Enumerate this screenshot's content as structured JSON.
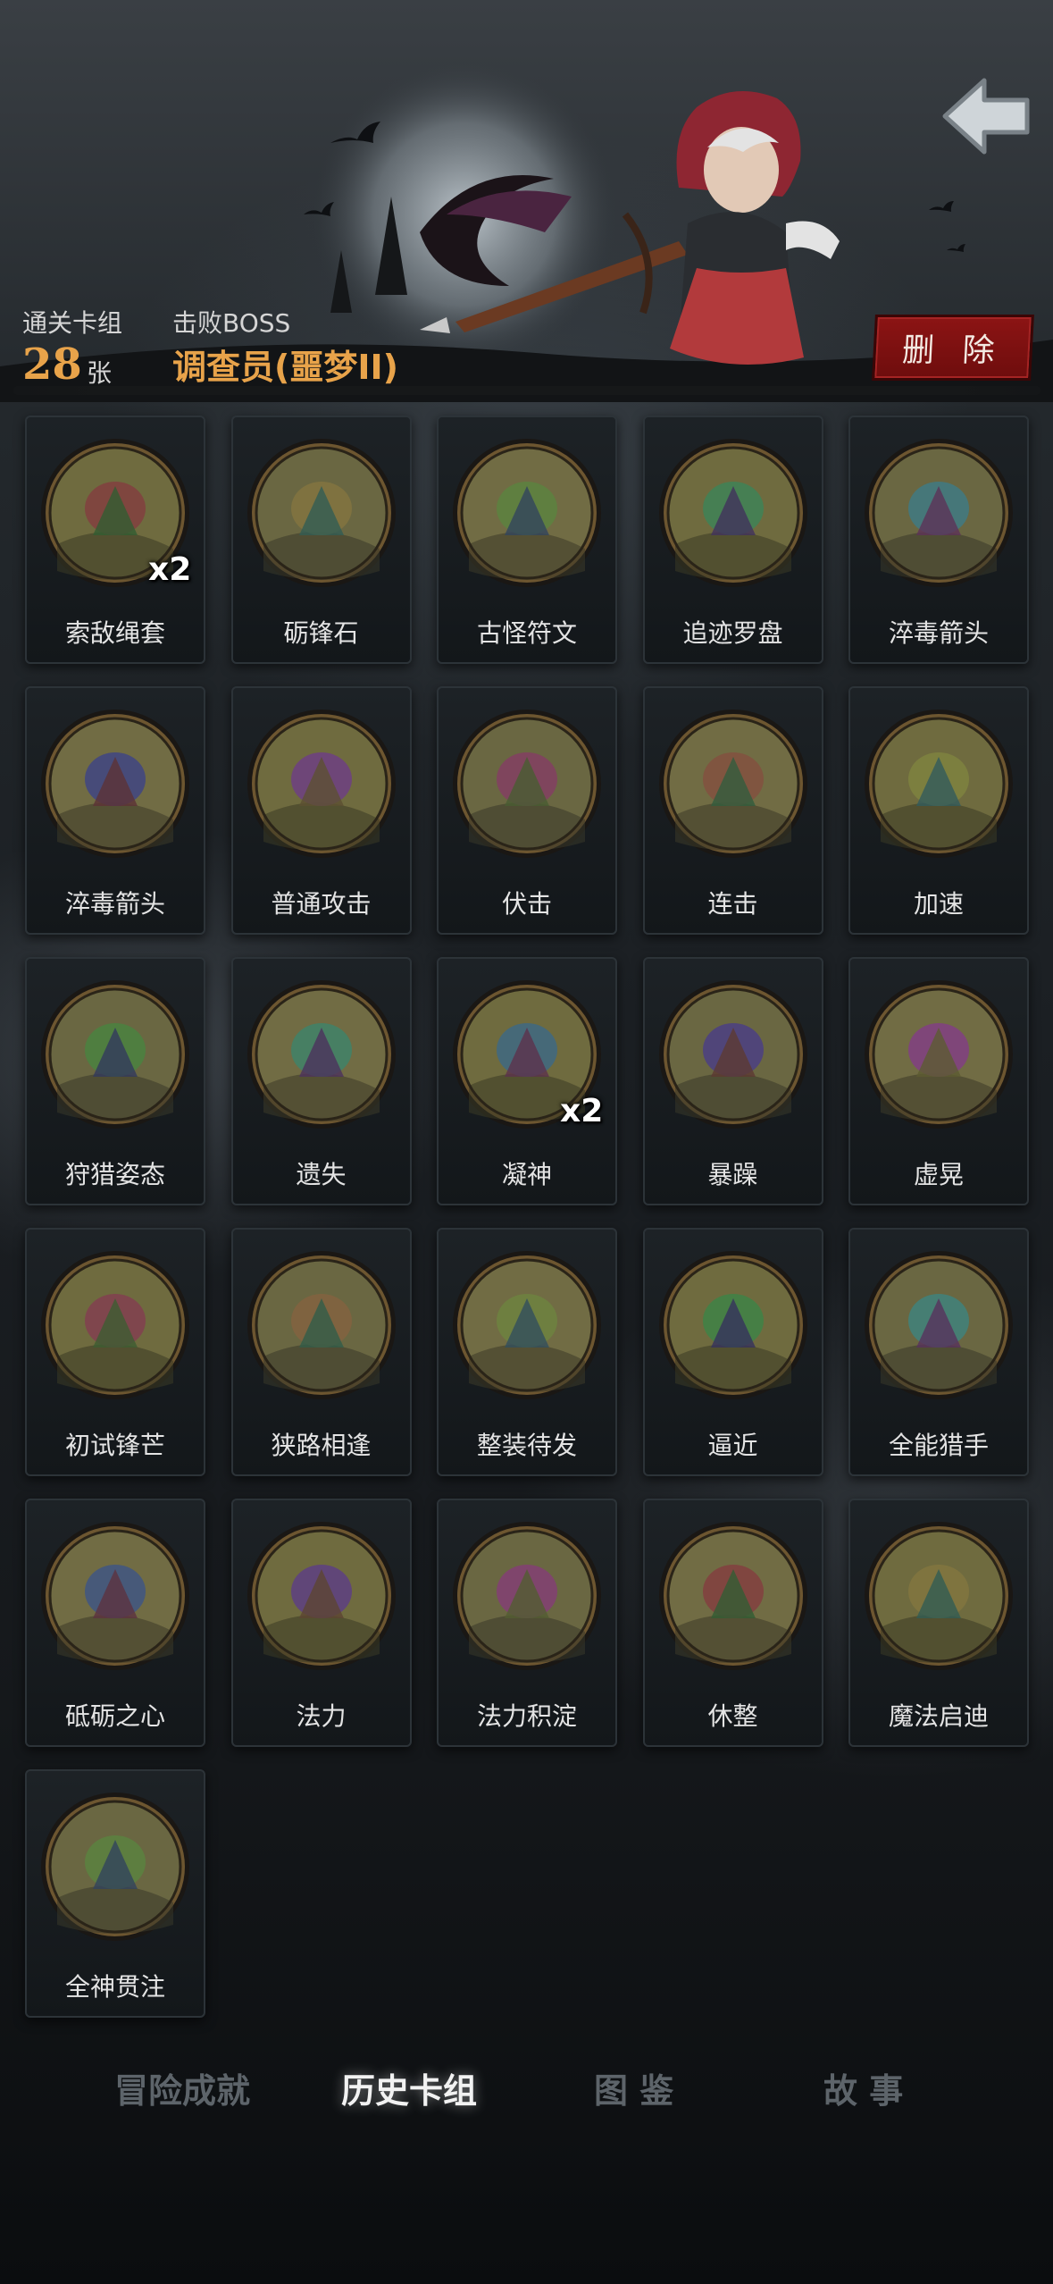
{
  "header": {
    "cleared_decks_label": "通关卡组",
    "card_count": "28",
    "card_unit": "张",
    "defeated_boss_label": "击败BOSS",
    "boss_name": "调查员(噩梦II)",
    "delete_label": "删 除",
    "back_icon": "back-arrow-icon"
  },
  "cards": [
    {
      "name": "索敌绳套",
      "count": "x2",
      "icon": "lasso-icon"
    },
    {
      "name": "砺锋石",
      "count": "",
      "icon": "whetstone-icon"
    },
    {
      "name": "古怪符文",
      "count": "",
      "icon": "rune-icon"
    },
    {
      "name": "追迹罗盘",
      "count": "",
      "icon": "compass-icon"
    },
    {
      "name": "淬毒箭头",
      "count": "",
      "icon": "poison-arrow-icon"
    },
    {
      "name": "淬毒箭头",
      "count": "",
      "icon": "poison-arrow-icon"
    },
    {
      "name": "普通攻击",
      "count": "",
      "icon": "slash-icon"
    },
    {
      "name": "伏击",
      "count": "",
      "icon": "ambush-icon"
    },
    {
      "name": "连击",
      "count": "",
      "icon": "combo-icon"
    },
    {
      "name": "加速",
      "count": "",
      "icon": "haste-icon"
    },
    {
      "name": "狩猎姿态",
      "count": "",
      "icon": "hunt-stance-icon"
    },
    {
      "name": "遗失",
      "count": "",
      "icon": "lost-icon"
    },
    {
      "name": "凝神",
      "count": "x2",
      "icon": "focus-icon"
    },
    {
      "name": "暴躁",
      "count": "",
      "icon": "rage-icon"
    },
    {
      "name": "虚晃",
      "count": "",
      "icon": "feint-icon"
    },
    {
      "name": "初试锋芒",
      "count": "",
      "icon": "first-blood-icon"
    },
    {
      "name": "狭路相逢",
      "count": "",
      "icon": "encounter-icon"
    },
    {
      "name": "整装待发",
      "count": "",
      "icon": "gear-up-icon"
    },
    {
      "name": "逼近",
      "count": "",
      "icon": "approach-icon"
    },
    {
      "name": "全能猎手",
      "count": "",
      "icon": "all-round-hunter-icon"
    },
    {
      "name": "砥砺之心",
      "count": "",
      "icon": "temper-heart-icon"
    },
    {
      "name": "法力",
      "count": "",
      "icon": "mana-orb-icon"
    },
    {
      "name": "法力积淀",
      "count": "",
      "icon": "mana-swirl-icon"
    },
    {
      "name": "休整",
      "count": "",
      "icon": "rest-icon"
    },
    {
      "name": "魔法启迪",
      "count": "",
      "icon": "magic-insight-icon"
    },
    {
      "name": "全神贯注",
      "count": "",
      "icon": "concentration-icon"
    }
  ],
  "tabs": [
    {
      "label": "冒险成就",
      "active": false
    },
    {
      "label": "历史卡组",
      "active": true
    },
    {
      "label": "图 鉴",
      "active": false
    },
    {
      "label": "故 事",
      "active": false
    }
  ],
  "colors": {
    "accent_orange": "#e8a34a",
    "delete_red": "#8c1414",
    "medallion_olive": "#6f6b3f"
  }
}
